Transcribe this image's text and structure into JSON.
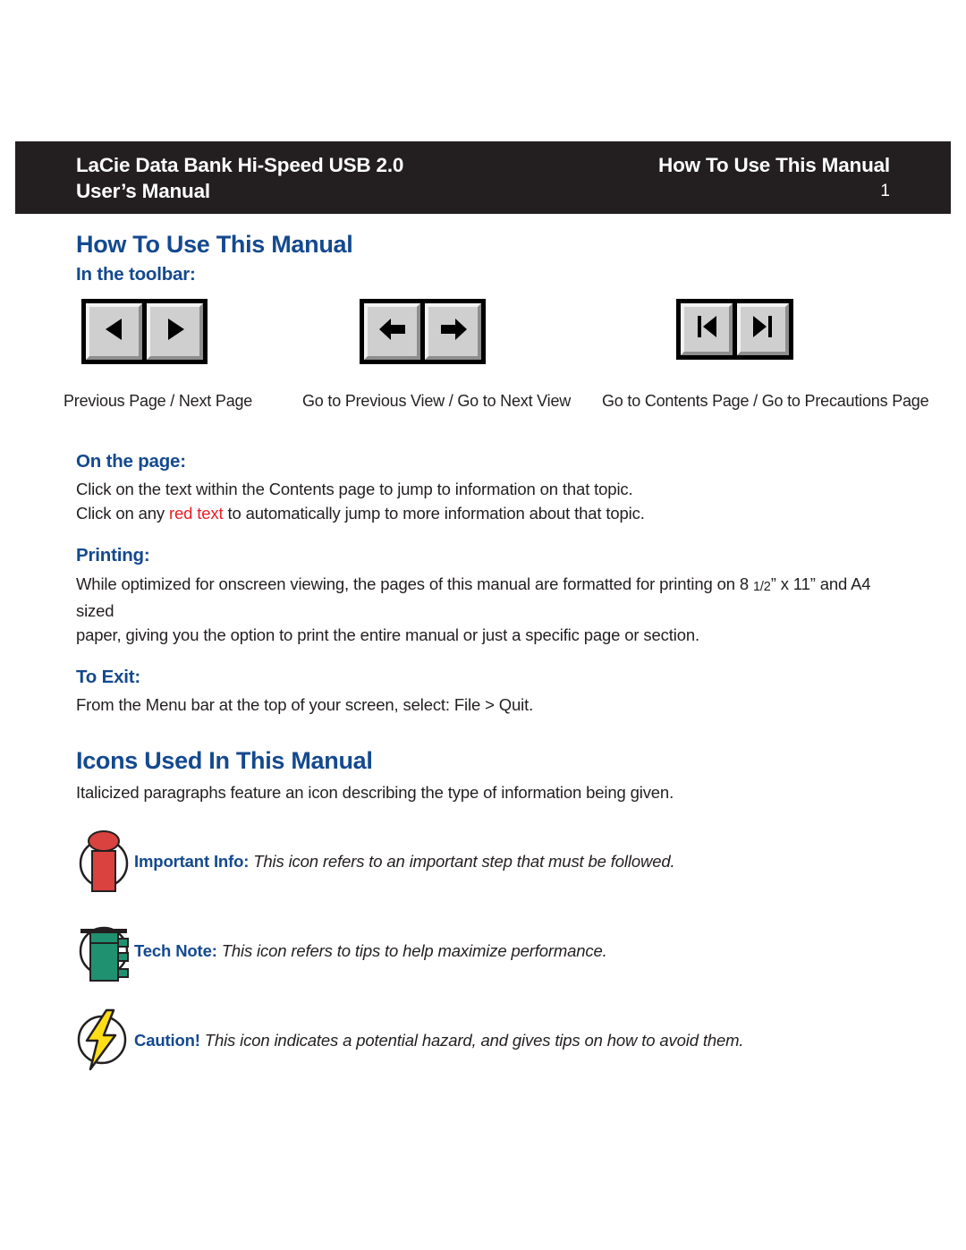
{
  "header": {
    "left_line1": "LaCie Data Bank Hi-Speed USB 2.0",
    "left_line2": "User’s Manual",
    "right_title": "How To Use This Manual",
    "page_number": "1",
    "bar_color": "#231f20",
    "text_color": "#ffffff"
  },
  "theme": {
    "heading_blue": "#14498f",
    "link_red": "#ec1c24",
    "body_black": "#231f20",
    "button_face": "#cfcfcf"
  },
  "main": {
    "title": "How To Use This Manual",
    "toolbar": {
      "heading": "In the toolbar:",
      "groups": [
        {
          "caption": "Previous Page / Next Page",
          "buttons": [
            "triangle-left-icon",
            "triangle-right-icon"
          ]
        },
        {
          "caption": "Go to Previous View / Go to Next View",
          "buttons": [
            "arrow-left-icon",
            "arrow-right-icon"
          ]
        },
        {
          "caption": "Go to Contents Page / Go to Precautions Page",
          "buttons": [
            "skip-to-start-icon",
            "skip-to-end-icon"
          ]
        }
      ]
    },
    "on_the_page": {
      "heading": "On the page:",
      "line1": "Click on the text within the Contents page to jump to information on that topic.",
      "line2_before": "Click on any ",
      "line2_link": "red text",
      "line2_after": " to automatically jump to more information about that topic."
    },
    "printing": {
      "heading": "Printing:",
      "line1_a": "While optimized for onscreen viewing, the pages of this manual are formatted for printing on 8 ",
      "line1_frac": "1/2",
      "line1_b": "” x 11” and A4 sized",
      "line2": "paper, giving you the option to print the entire manual or just a specific page or section."
    },
    "to_exit": {
      "heading": "To Exit:",
      "line1": "From the Menu bar at the top of your screen, select: File > Quit."
    }
  },
  "icons_section": {
    "title": "Icons Used In This Manual",
    "intro": "Italicized paragraphs feature an icon describing the type of information being given.",
    "notes": [
      {
        "icon": "important-info-icon",
        "lead": "Important Info:",
        "text": " This icon refers to an important step that must be followed."
      },
      {
        "icon": "tech-note-icon",
        "lead": "Tech Note:",
        "text": " This icon refers to tips to help maximize performance."
      },
      {
        "icon": "caution-icon",
        "lead": "Caution!",
        "text": " This icon indicates a potential hazard, and gives tips on how to avoid them."
      }
    ]
  }
}
